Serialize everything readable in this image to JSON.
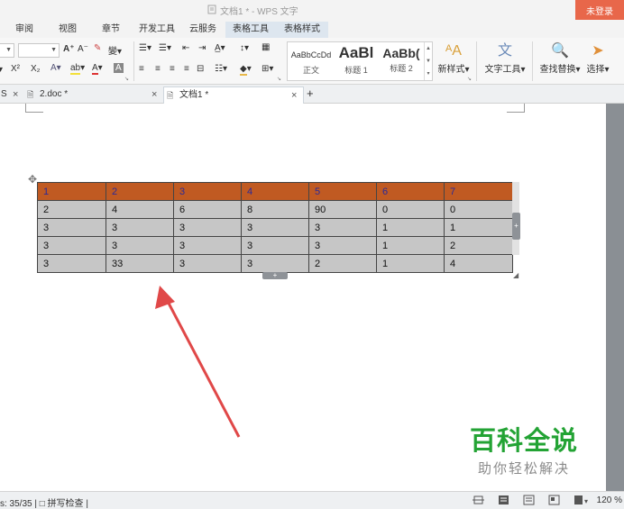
{
  "titlebar": {
    "title": "文档1 * - WPS 文字",
    "login": "未登录"
  },
  "ribbon_tabs": [
    {
      "label": "审阅"
    },
    {
      "label": "视图"
    },
    {
      "label": "章节"
    },
    {
      "label": "开发工具"
    },
    {
      "label": "云服务"
    },
    {
      "label": "表格工具"
    },
    {
      "label": "表格样式"
    }
  ],
  "ribbon": {
    "styles": [
      {
        "sample": "AaBbCcDd",
        "caption": "正文"
      },
      {
        "sample": "AaBl",
        "caption": "标题 1"
      },
      {
        "sample": "AaBb(",
        "caption": "标题 2"
      }
    ],
    "new_style": "新样式",
    "text_tools": "文字工具",
    "find_replace": "查找替换",
    "select": "选择"
  },
  "doc_tabs": {
    "first": "S",
    "second": "2.doc *",
    "third": "文档1 *",
    "add": "+"
  },
  "table": {
    "header": [
      "1",
      "2",
      "3",
      "4",
      "5",
      "6",
      "7"
    ],
    "rows": [
      [
        "2",
        "4",
        "6",
        "8",
        "90",
        "0",
        "0"
      ],
      [
        "3",
        "3",
        "3",
        "3",
        "3",
        "1",
        "1"
      ],
      [
        "3",
        "3",
        "3",
        "3",
        "3",
        "1",
        "2"
      ],
      [
        "3",
        "33",
        "3",
        "3",
        "2",
        "1",
        "4"
      ]
    ]
  },
  "watermark": {
    "brand": "百科全说",
    "tagline": "助你轻松解决"
  },
  "statusbar": {
    "left": "s: 35/35 | □ 拼写检查 |",
    "zoom": "120 %"
  },
  "colors": {
    "header_fill": "#c05a22",
    "header_text": "#2a2a9a",
    "cell_fill": "#c6c6c6",
    "arrow": "#e04848",
    "brand_green": "#23a334",
    "login_bg": "#e8674a"
  }
}
